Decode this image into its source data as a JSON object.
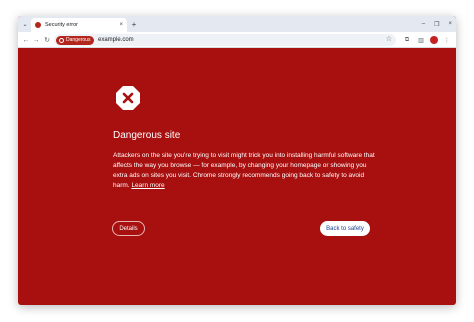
{
  "tab": {
    "title": "Security error",
    "close_glyph": "×",
    "favicon": "danger-icon",
    "search_glyph": "⌄",
    "new_tab_glyph": "+"
  },
  "window_controls": {
    "minimize": "–",
    "restore": "❐",
    "close": "×"
  },
  "toolbar": {
    "back_glyph": "←",
    "forward_glyph": "→",
    "reload_glyph": "↻",
    "security_chip": "Dangerous",
    "url": "example.com",
    "bookmark_glyph": "☆",
    "extensions_glyph": "⧉",
    "sidepanel_glyph": "▥",
    "profile_initial": "",
    "menu_glyph": "⋮"
  },
  "interstitial": {
    "heading": "Dangerous site",
    "body": "Attackers on the site you're trying to visit might trick you into installing harmful software that affects the way you browse — for example, by changing your homepage or showing you extra ads on sites you visit. Chrome strongly recommends going back to safety to avoid harm.",
    "learn_more": "Learn more",
    "details_button": "Details",
    "back_button": "Back to safety"
  },
  "colors": {
    "danger_background": "#a80f0f",
    "chip": "#b3261e",
    "primary_button_text": "#1a3f8f"
  }
}
